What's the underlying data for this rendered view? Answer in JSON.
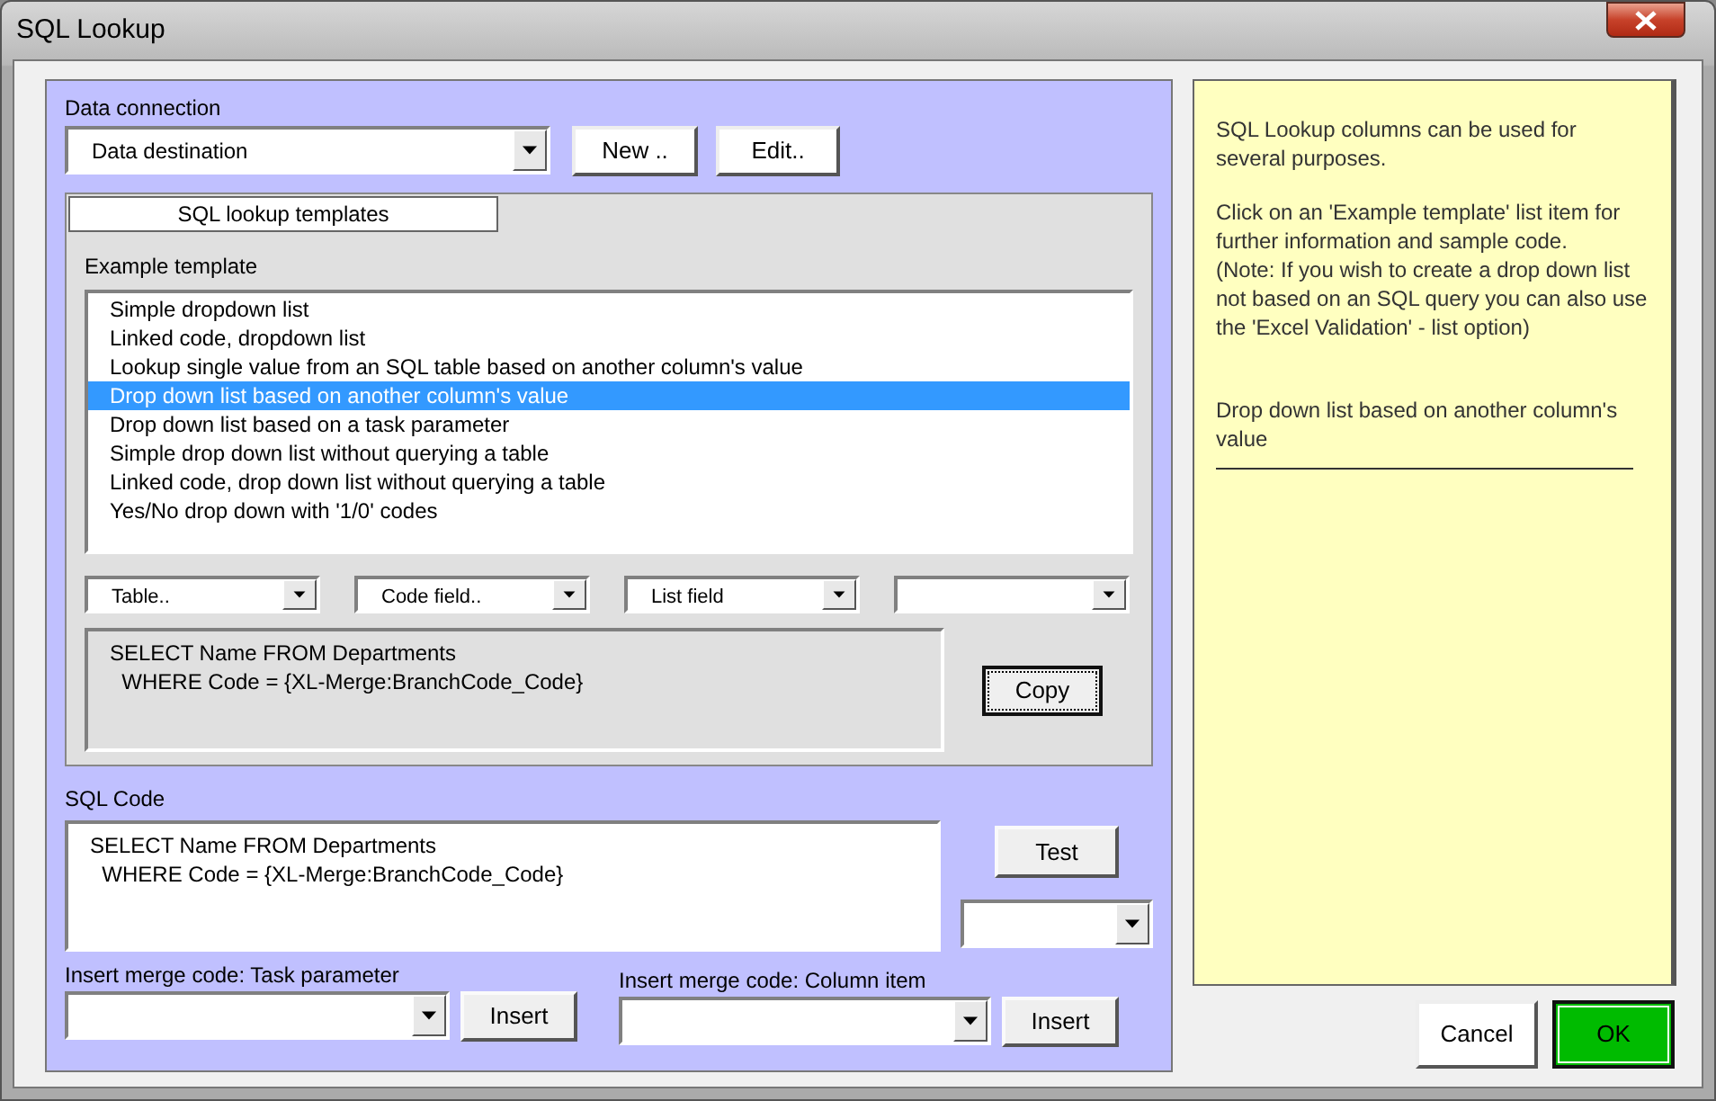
{
  "window": {
    "title": "SQL Lookup"
  },
  "data_connection": {
    "label": "Data connection",
    "value": "Data destination",
    "buttons": [
      "New ..",
      "Edit.."
    ]
  },
  "templates_tab": {
    "label": "SQL lookup templates"
  },
  "example_template": {
    "label": "Example template",
    "items": [
      {
        "label": "Simple dropdown list",
        "selected": false
      },
      {
        "label": "Linked code, dropdown list",
        "selected": false
      },
      {
        "label": "Lookup single value from an SQL table based on another column's value",
        "selected": false
      },
      {
        "label": "Drop down list based on another column's value",
        "selected": true
      },
      {
        "label": "Drop down list based on a task parameter",
        "selected": false
      },
      {
        "label": "Simple drop down list without querying a table",
        "selected": false
      },
      {
        "label": "Linked code, drop down list without querying a table",
        "selected": false
      },
      {
        "label": "Yes/No drop down with '1/0' codes",
        "selected": false
      }
    ]
  },
  "field_dropdowns": [
    "Table..",
    "Code field..",
    "List field"
  ],
  "preview": {
    "sql": "SELECT Name FROM Departments\n  WHERE Code = {XL-Merge:BranchCode_Code}",
    "button": "Copy"
  },
  "sql_code": {
    "label": "SQL Code",
    "sql": "SELECT Name FROM Departments\n  WHERE Code = {XL-Merge:BranchCode_Code}",
    "button": "Test"
  },
  "insert_task": {
    "label": "Insert merge code: Task parameter",
    "button": "Insert"
  },
  "insert_column": {
    "label": "Insert merge code: Column item",
    "button": "Insert"
  },
  "help": {
    "paragraphs": [
      "SQL Lookup columns can be used for several purposes.",
      "Click on an 'Example template' list item for further information and sample code.",
      "(Note: If you wish to create a drop down list not based on an SQL query you can also use the 'Excel Validation' - list option)"
    ],
    "description": "Drop down list based on another column's value"
  },
  "footer": {
    "cancel": "Cancel",
    "ok": "OK"
  }
}
